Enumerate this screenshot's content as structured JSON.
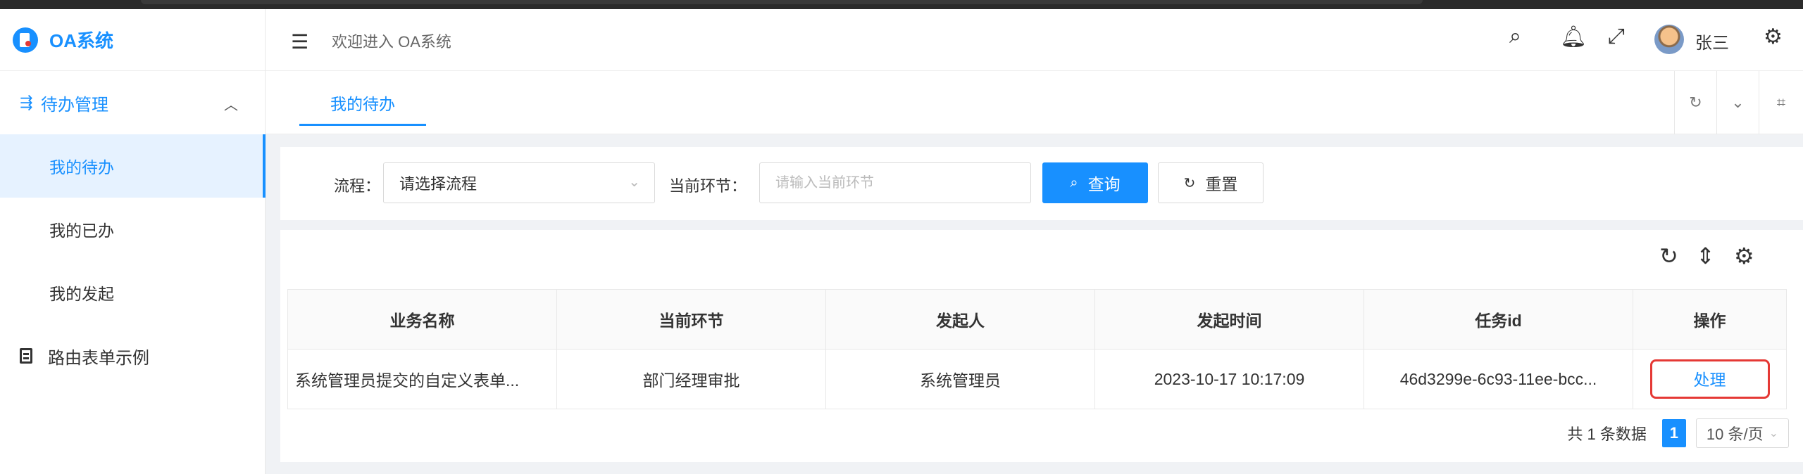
{
  "app": {
    "title": "OA系统"
  },
  "header": {
    "welcome": "欢迎进入 OA系统",
    "username": "张三",
    "icons": [
      "menu-fold-icon",
      "search-icon",
      "bell-icon",
      "fullscreen-icon",
      "avatar",
      "gear-icon"
    ]
  },
  "sidebar": {
    "group": {
      "label": "待办管理",
      "icon": "flow-icon",
      "expanded": true
    },
    "items": [
      {
        "label": "我的待办",
        "active": true
      },
      {
        "label": "我的已办",
        "active": false
      },
      {
        "label": "我的发起",
        "active": false
      }
    ],
    "root_item": {
      "label": "路由表单示例",
      "icon": "form-icon"
    }
  },
  "tabs": [
    {
      "label": "我的待办",
      "active": true
    }
  ],
  "filter": {
    "process_label": "流程：",
    "process_value": "请选择流程",
    "node_label": "当前环节：",
    "node_placeholder": "请输入当前环节",
    "query_label": "查询",
    "reset_label": "重置"
  },
  "table": {
    "columns": [
      "业务名称",
      "当前环节",
      "发起人",
      "发起时间",
      "任务id",
      "操作"
    ],
    "rows": [
      {
        "name": "系统管理员提交的自定义表单...",
        "node": "部门经理审批",
        "initiator": "系统管理员",
        "time": "2023-10-17 10:17:09",
        "task_id": "46d3299e-6c93-11ee-bcc...",
        "action": "处理"
      }
    ]
  },
  "pagination": {
    "total_text": "共 1 条数据",
    "current_page": "1",
    "page_size": "10 条/页"
  },
  "colors": {
    "primary": "#1890ff",
    "highlight_border": "#e53935"
  }
}
